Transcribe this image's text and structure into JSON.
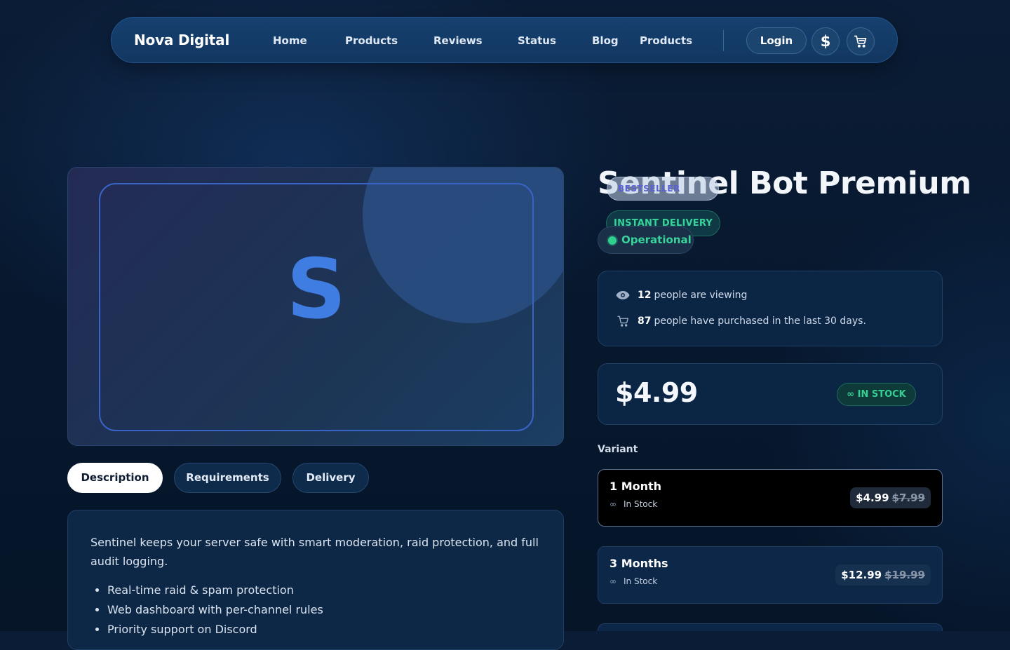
{
  "nav": {
    "brand": "Nova Digital",
    "links": [
      "Home",
      "Products",
      "Reviews",
      "Status",
      "Blog",
      "Products"
    ],
    "login_label": "Login",
    "currency_icon": "dollar-icon",
    "cart_icon": "cart-icon"
  },
  "product_image": {
    "letter": "S"
  },
  "tabs": [
    {
      "label": "Description",
      "active": true
    },
    {
      "label": "Requirements",
      "active": false
    },
    {
      "label": "Delivery",
      "active": false
    }
  ],
  "description": {
    "text": "Sentinel keeps your server safe with smart moderation, raid protection, and full audit logging.",
    "bullets": [
      "Real-time raid & spam protection",
      "Web dashboard with per-channel rules",
      "Priority support on Discord"
    ]
  },
  "product": {
    "title": "Sentinel Bot Premium",
    "badge_bestseller": "BESTSELLER",
    "badge_instant": "INSTANT DELIVERY",
    "status": "Operational"
  },
  "social": {
    "viewing_count": "12",
    "viewing_text": "people are viewing",
    "purchased_count": "87",
    "purchased_text": "people have purchased in the last 30 days."
  },
  "pricing": {
    "price": "$4.99",
    "stock_label": "IN STOCK",
    "stock_symbol": "∞"
  },
  "variants": {
    "label": "Variant",
    "items": [
      {
        "name": "1 Month",
        "stock": "In Stock",
        "price": "$4.99",
        "old_price": "$7.99",
        "selected": true
      },
      {
        "name": "3 Months",
        "stock": "In Stock",
        "price": "$12.99",
        "old_price": "$19.99",
        "selected": false
      }
    ]
  },
  "colors": {
    "background": "#07182e",
    "accent": "#3f7de3",
    "success": "#36cf93",
    "navbar": "#16406f"
  }
}
